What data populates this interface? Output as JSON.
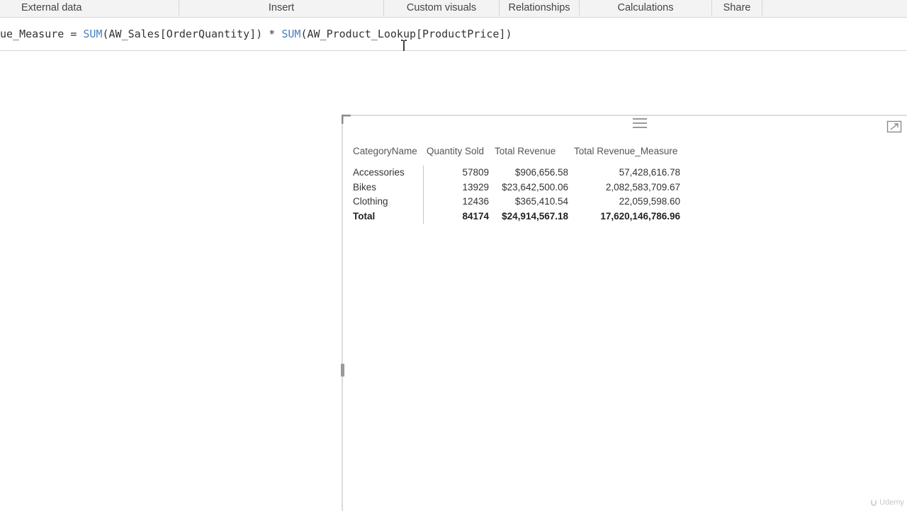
{
  "ribbon": {
    "groups": [
      {
        "label": "External data"
      },
      {
        "label": "Insert"
      },
      {
        "label": "Custom visuals"
      },
      {
        "label": "Relationships"
      },
      {
        "label": "Calculations"
      },
      {
        "label": "Share"
      }
    ]
  },
  "formula": {
    "part1": "ue_Measure = ",
    "func1": "SUM",
    "part2": "(AW_Sales[OrderQuantity]) * ",
    "func2": "SUM",
    "part3": "(AW_Product_Lookup[ProductPrice])"
  },
  "table": {
    "columns": [
      "CategoryName",
      "Quantity Sold",
      "Total Revenue",
      "Total Revenue_Measure"
    ],
    "rows": [
      [
        "Accessories",
        "57809",
        "$906,656.58",
        "57,428,616.78"
      ],
      [
        "Bikes",
        "13929",
        "$23,642,500.06",
        "2,082,583,709.67"
      ],
      [
        "Clothing",
        "12436",
        "$365,410.54",
        "22,059,598.60"
      ]
    ],
    "total": [
      "Total",
      "84174",
      "$24,914,567.18",
      "17,620,146,786.96"
    ]
  },
  "icons": {
    "drag_handle": "drag-handle-icon",
    "focus_mode": "focus-mode-icon",
    "corner": "corner-bracket-icon",
    "cursor": "text-cursor-icon"
  },
  "colors": {
    "function_keyword": "#4a7fc0",
    "header_underline": "#c9e8e6",
    "column_divider": "#9fd6d2",
    "band_row": "#eeeeee"
  },
  "watermark": {
    "text": "Udemy"
  }
}
